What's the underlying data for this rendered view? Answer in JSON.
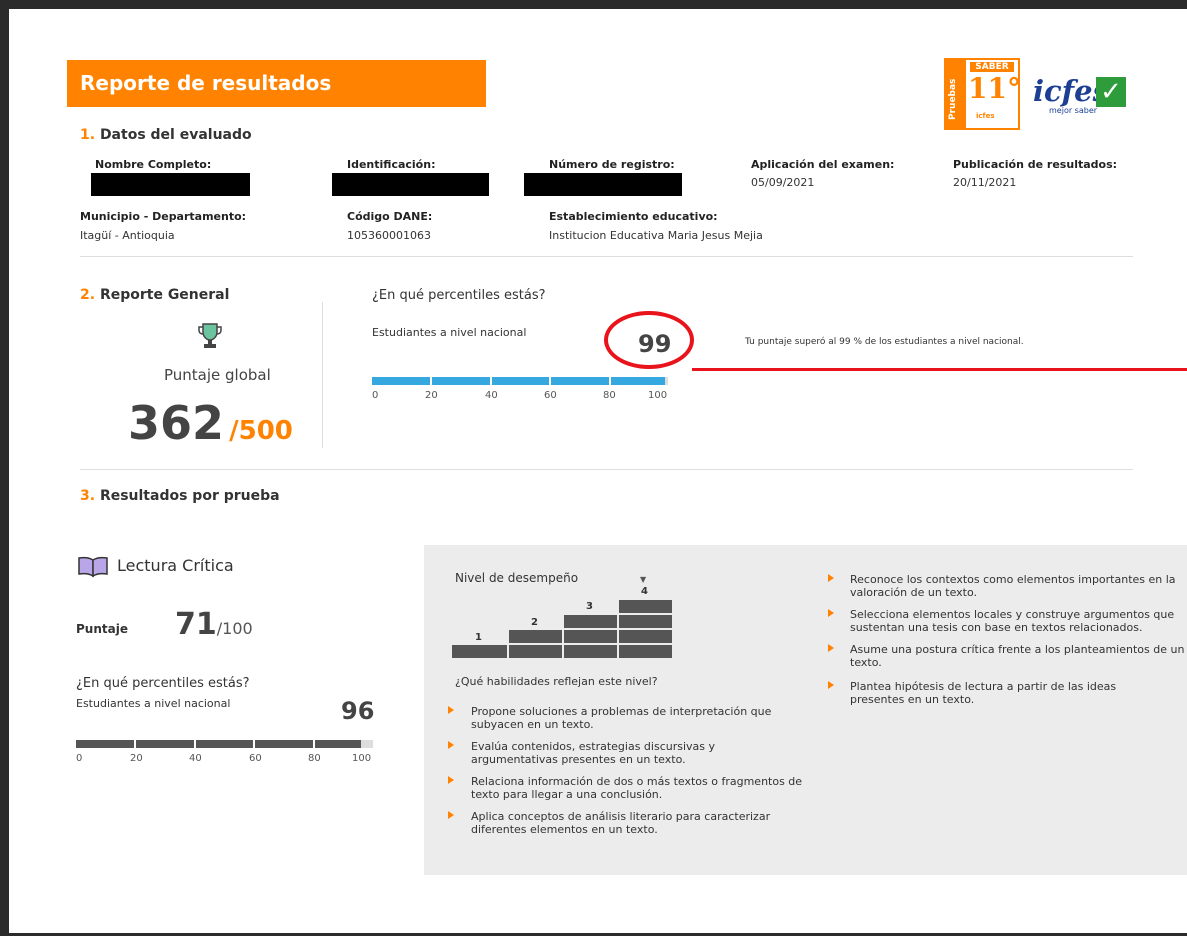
{
  "header": {
    "title": "Reporte de resultados",
    "logo_saber": {
      "pruebas": "Pruebas",
      "saber": "SABER",
      "grade": "11°",
      "mini": "icfes"
    },
    "logo_icfes": {
      "word": "icfes",
      "tagline": "mejor saber",
      "check": "✓"
    }
  },
  "section1": {
    "number": "1.",
    "title": "Datos del evaluado",
    "fields": {
      "nombre_label": "Nombre Completo:",
      "identificacion_label": "Identificación:",
      "registro_label": "Número de registro:",
      "aplicacion_label": "Aplicación del examen:",
      "aplicacion_value": "05/09/2021",
      "publicacion_label": "Publicación de resultados:",
      "publicacion_value": "20/11/2021",
      "municipio_label": "Municipio - Departamento:",
      "municipio_value": "Itagüí - Antioquia",
      "dane_label": "Código DANE:",
      "dane_value": "105360001063",
      "establecimiento_label": "Establecimiento educativo:",
      "establecimiento_value": "Institucion Educativa Maria Jesus Mejia"
    }
  },
  "section2": {
    "number": "2.",
    "title": "Reporte General",
    "puntaje_label": "Puntaje global",
    "score": "362",
    "score_max": "/500",
    "percentile_question": "¿En qué percentiles estás?",
    "nacional_label": "Estudiantes a nivel nacional",
    "percentile": "99",
    "percentile_value": 99,
    "percentile_note": "Tu puntaje superó al 99 % de los estudiantes a nivel nacional.",
    "axis": [
      "0",
      "20",
      "40",
      "60",
      "80",
      "100"
    ]
  },
  "section3": {
    "number": "3.",
    "title": "Resultados por prueba",
    "subject": "Lectura Crítica",
    "puntaje_label": "Puntaje",
    "score": "71",
    "score_max": "/100",
    "percentile_question": "¿En qué percentiles estás?",
    "nacional_label": "Estudiantes a nivel nacional",
    "percentile": "96",
    "percentile_value": 96,
    "axis": [
      "0",
      "20",
      "40",
      "60",
      "80",
      "100"
    ],
    "nivel_title": "Nivel de desempeño",
    "levels": [
      "1",
      "2",
      "3",
      "4"
    ],
    "current_level": 4,
    "marker": "▼",
    "habilidades_question": "¿Qué habilidades reflejan este nivel?",
    "bullets_left": [
      "Propone soluciones a problemas de interpretación que subyacen en un texto.",
      "Evalúa contenidos, estrategias discursivas y argumentativas presentes en un texto.",
      "Relaciona información de dos o más textos o fragmentos de texto para llegar a una conclusión.",
      "Aplica conceptos de análisis literario para caracterizar diferentes elementos en un texto."
    ],
    "bullets_right": [
      "Reconoce los contextos como elementos importantes en la valoración de un texto.",
      "Selecciona elementos locales y construye argumentos que sustentan una tesis con base en textos relacionados.",
      "Asume una postura crítica frente a los planteamientos de un texto.",
      "Plantea hipótesis de lectura a partir de las ideas presentes en un texto."
    ]
  },
  "colors": {
    "accent": "#ff8300",
    "bar_blue": "#35a8e0",
    "highlight_red": "#e8131b",
    "dark_gray": "#555555"
  }
}
